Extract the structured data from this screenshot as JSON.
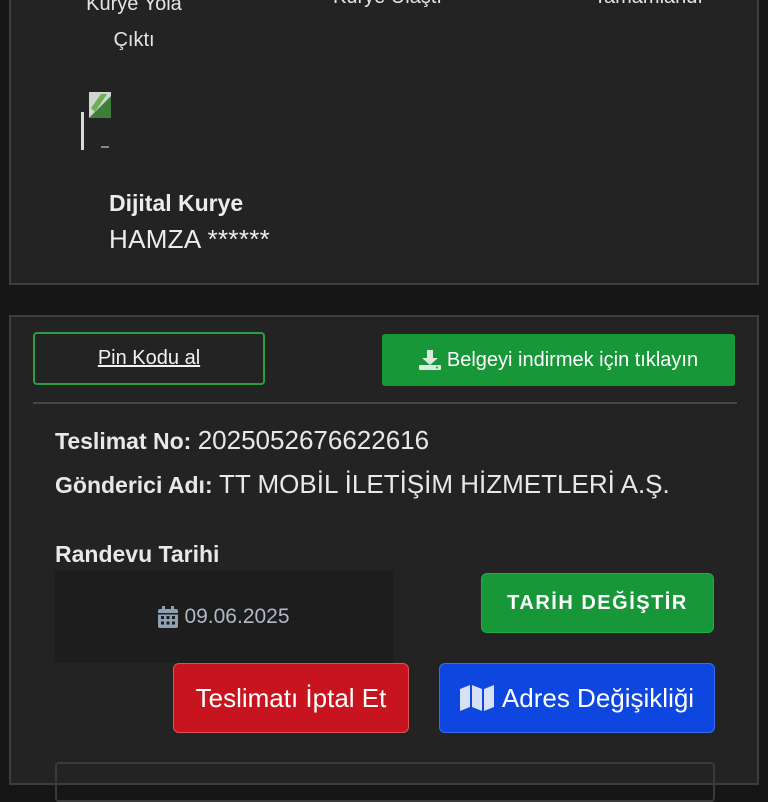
{
  "tracking": {
    "steps": [
      "Kurye Yola\nÇıktı",
      "Kurye Ulaştı",
      "Tamamlandı"
    ],
    "courier_title": "Dijital Kurye",
    "courier_name": "HAMZA ******"
  },
  "actions": {
    "pin_label": "Pin Kodu al",
    "download_label": "Belgeyi indirmek için tıklayın"
  },
  "delivery": {
    "no_label": "Teslimat No:",
    "no_value": "2025052676622616",
    "sender_label": "Gönderici Adı:",
    "sender_value": "TT MOBİL İLETİŞİM HİZMETLERİ A.Ş.",
    "appointment_label": "Randevu Tarihi",
    "appointment_date": "09.06.2025"
  },
  "buttons": {
    "change_date": "TARİH DEĞİŞTİR",
    "cancel": "Teslimatı İptal Et",
    "address_change": "Adres Değişikliği"
  },
  "colors": {
    "background": "#161616",
    "card": "#232323",
    "green": "#179738",
    "red": "#c8141e",
    "blue": "#0d47e0"
  },
  "icons": {
    "download": "download-icon",
    "calendar": "calendar-icon",
    "map": "map-icon"
  }
}
